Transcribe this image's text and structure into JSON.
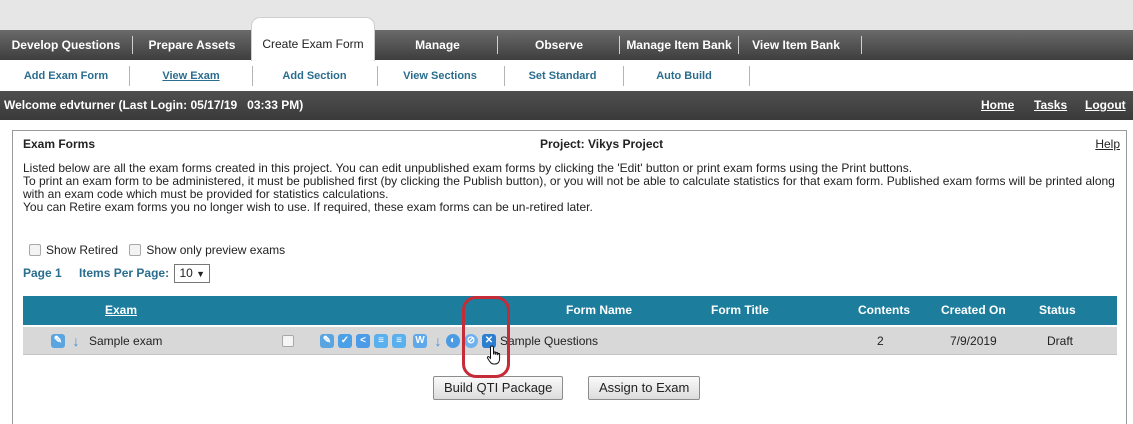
{
  "nav": {
    "tabs": [
      {
        "label": "Develop Questions"
      },
      {
        "label": "Prepare Assets"
      },
      {
        "label": "Create Exam Form"
      },
      {
        "label": "Manage"
      },
      {
        "label": "Observe"
      },
      {
        "label": "Manage Item Bank"
      },
      {
        "label": "View Item Bank"
      }
    ],
    "active_tab": "Create Exam Form"
  },
  "subnav": {
    "links": [
      {
        "label": "Add Exam Form"
      },
      {
        "label": "View Exam"
      },
      {
        "label": "Add Section"
      },
      {
        "label": "View Sections"
      },
      {
        "label": "Set Standard"
      },
      {
        "label": "Auto Build"
      }
    ],
    "current": "View Exam"
  },
  "welcome": {
    "text": "Welcome edvturner (Last Login: 05/17/19   03:33 PM)",
    "links": {
      "home": "Home",
      "tasks": "Tasks",
      "logout": "Logout"
    }
  },
  "panel": {
    "title": "Exam Forms",
    "project": "Project: Vikys Project",
    "help": "Help",
    "description": [
      "Listed below are all the exam forms created in this project. You can edit unpublished exam forms by clicking the 'Edit' button or print exam forms using the Print buttons.",
      "To print an exam form to be administered, it must be published first (by clicking the Publish button), or you will not be able to calculate statistics for that exam form. Published exam forms will be printed along with an exam code which must be provided for statistics calculations.",
      "You can Retire exam forms you no longer wish to use. If required, these exam forms can be un-retired later."
    ],
    "filters": {
      "show_retired": "Show Retired",
      "show_preview": "Show only preview exams"
    },
    "pager": {
      "page": "Page 1",
      "items_per_page_label": "Items Per Page:",
      "items_per_page_value": "10"
    }
  },
  "table": {
    "headers": {
      "exam": "Exam",
      "form_name": "Form Name",
      "form_title": "Form Title",
      "contents": "Contents",
      "created_on": "Created On",
      "status": "Status"
    },
    "rows": [
      {
        "exam": "Sample exam",
        "form_name": "Sample Questions",
        "form_title": "",
        "contents": "2",
        "created_on": "7/9/2019",
        "status": "Draft"
      }
    ]
  },
  "actions": {
    "build_qti": "Build QTI Package",
    "assign": "Assign to Exam"
  },
  "colors": {
    "header_teal": "#1d7d9c",
    "link_blue": "#2a6d8e",
    "highlight_red": "#c62b38"
  }
}
